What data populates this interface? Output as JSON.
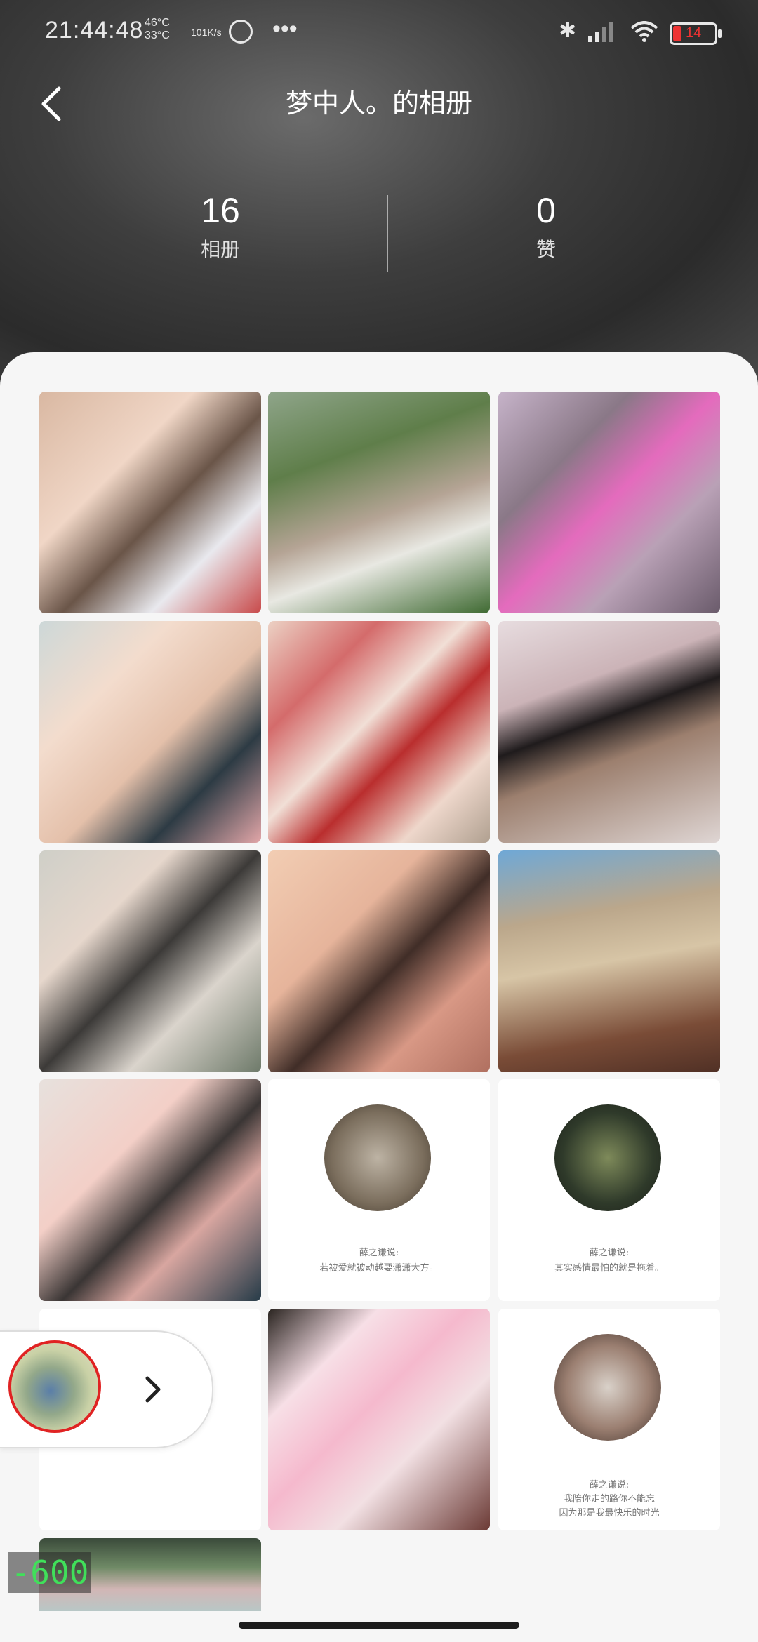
{
  "status_bar": {
    "time": "21:44:48",
    "temp_top": "46°C",
    "temp_bottom": "33°C",
    "net_speed": "101K/s",
    "more": "•••",
    "battery": "14"
  },
  "header": {
    "title": "梦中人。的相册"
  },
  "stats": [
    {
      "value": "16",
      "label": "相册"
    },
    {
      "value": "0",
      "label": "赞"
    }
  ],
  "grid": {
    "captions": {
      "c1": [
        "薛之谦说:",
        "若被爱就被动越要潇潇大方。"
      ],
      "c2": [
        "薛之谦说:",
        "其实感情最怕的就是拖着。"
      ],
      "c3": [
        "薛之谦说:",
        "我陪你走的路你不能忘",
        "因为那是我最快乐的时光"
      ]
    },
    "colors": {
      "accent_red": "#e02323",
      "counter_green": "#40e05a"
    }
  },
  "floating_player": {
    "arrow_icon": "chevron-right-icon"
  },
  "debug_counter": "-600"
}
